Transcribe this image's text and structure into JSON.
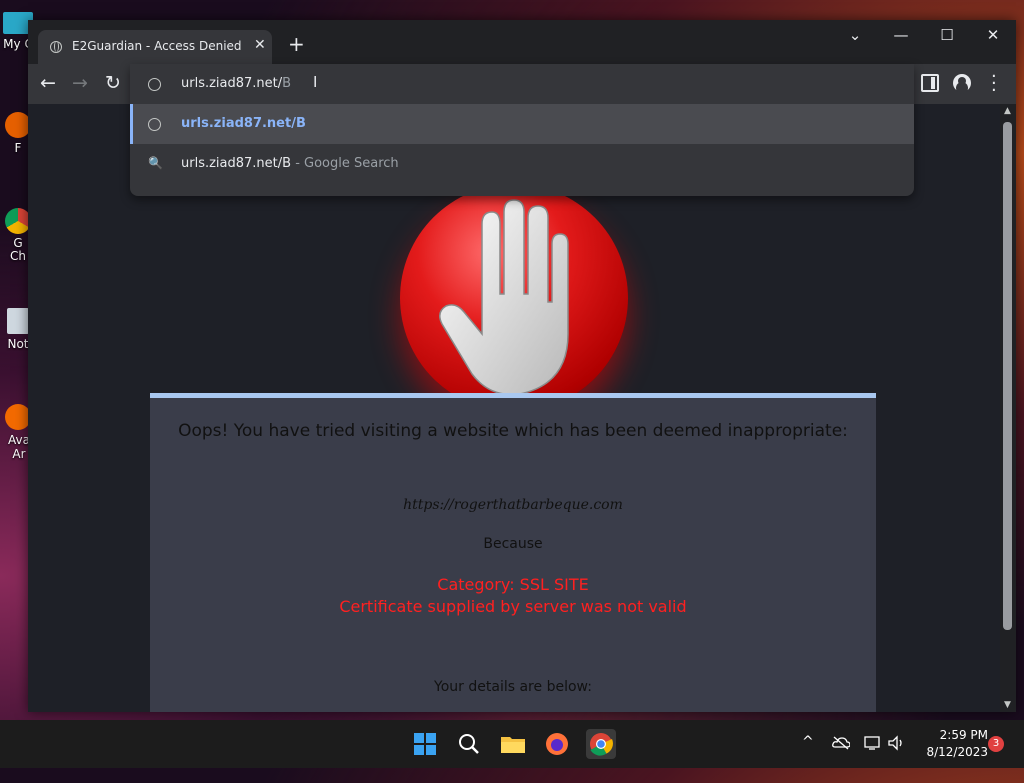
{
  "desktop": {
    "icons": [
      {
        "label": "My C",
        "icon": "computer-icon"
      },
      {
        "label": "F",
        "icon": "firefox-icon"
      },
      {
        "label": "G Ch",
        "icon": "chrome-icon"
      },
      {
        "label": "Not",
        "icon": "notepad-icon"
      },
      {
        "label": "Ava Ar",
        "icon": "avast-icon"
      }
    ]
  },
  "browser": {
    "tab": {
      "title": "E2Guardian - Access Denied",
      "close": "✕"
    },
    "new_tab": "+",
    "window_controls": {
      "dropdown": "⌄",
      "minimize": "—",
      "maximize": "☐",
      "close": "✕"
    },
    "nav": {
      "back": "←",
      "forward": "→",
      "reload": "↻"
    },
    "omnibox": {
      "typed": "urls.ziad87.net/",
      "autocomplete": "B",
      "suggestions": [
        {
          "text": "urls.ziad87.net/B",
          "sub": "",
          "icon": "globe-icon",
          "selected": true
        },
        {
          "text": "urls.ziad87.net/B",
          "sub": " - Google Search",
          "icon": "search-icon",
          "selected": false
        }
      ]
    }
  },
  "page": {
    "headline": "Oops! You have tried visiting a website which has been deemed inappropriate:",
    "url": "https://rogerthatbarbeque.com",
    "because": "Because",
    "category": "Category: SSL SITE",
    "reason": "Certificate supplied by server was not valid",
    "details": "Your details are below:"
  },
  "taskbar": {
    "apps": [
      "windows-start-icon",
      "search-icon",
      "file-explorer-icon",
      "firefox-icon",
      "chrome-icon"
    ],
    "time": "2:59 PM",
    "date": "8/12/2023",
    "notifications": "3"
  },
  "colors": {
    "accent": "#8ab4f8",
    "alert_red": "#ff2020",
    "panel_border": "#a9c8f0"
  }
}
